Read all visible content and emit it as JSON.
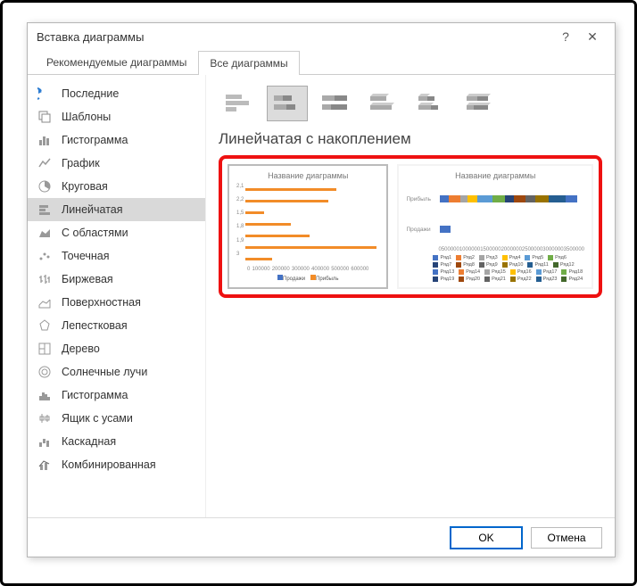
{
  "dialog": {
    "title": "Вставка диаграммы",
    "help": "?",
    "close": "✕"
  },
  "tabs": {
    "recommended": "Рекомендуемые диаграммы",
    "all": "Все диаграммы"
  },
  "sidebar": [
    "Последние",
    "Шаблоны",
    "Гистограмма",
    "График",
    "Круговая",
    "Линейчатая",
    "С областями",
    "Точечная",
    "Биржевая",
    "Поверхностная",
    "Лепестковая",
    "Дерево",
    "Солнечные лучи",
    "Гистограмма",
    "Ящик с усами",
    "Каскадная",
    "Комбинированная"
  ],
  "subtypeHeading": "Линейчатая с накоплением",
  "preview1": {
    "title": "Название диаграммы",
    "ylabels": [
      "2,1",
      "2,2",
      "1,5",
      "1,8",
      "1,9",
      "3",
      ""
    ],
    "xlabels": [
      "0",
      "100000",
      "200000",
      "300000",
      "400000",
      "500000",
      "600000"
    ],
    "legend": [
      "Продажи",
      "Прибыль"
    ]
  },
  "preview2": {
    "title": "Название диаграммы",
    "rows": [
      "Прибыль",
      "Продажи"
    ],
    "xlabels": [
      "0",
      "500000",
      "1000000",
      "1500000",
      "2000000",
      "2500000",
      "3000000",
      "3500000"
    ],
    "legend": [
      "Ряд1",
      "Ряд2",
      "Ряд3",
      "Ряд4",
      "Ряд5",
      "Ряд6",
      "Ряд7",
      "Ряд8",
      "Ряд9",
      "Ряд10",
      "Ряд11",
      "Ряд12",
      "Ряд13",
      "Ряд14",
      "Ряд15",
      "Ряд16",
      "Ряд17",
      "Ряд18",
      "Ряд19",
      "Ряд20",
      "Ряд21",
      "Ряд22",
      "Ряд23",
      "Ряд24"
    ]
  },
  "footer": {
    "ok": "OK",
    "cancel": "Отмена"
  },
  "chart_data": [
    {
      "type": "bar",
      "orientation": "horizontal",
      "stacked": true,
      "title": "Название диаграммы",
      "categories": [
        "2,1",
        "2,2",
        "1,5",
        "1,8",
        "1,9",
        "3",
        ""
      ],
      "series": [
        {
          "name": "Продажи",
          "color": "#4472c4",
          "values": [
            30000,
            20000,
            10000,
            15000,
            10000,
            50000,
            40000
          ]
        },
        {
          "name": "Прибыль",
          "color": "#f28c28",
          "values": [
            380000,
            350000,
            70000,
            190000,
            280000,
            550000,
            80000
          ]
        }
      ],
      "xlim": [
        0,
        600000
      ]
    },
    {
      "type": "bar",
      "orientation": "horizontal",
      "stacked": true,
      "title": "Название диаграммы",
      "categories": [
        "Прибыль",
        "Продажи"
      ],
      "series_count": 24,
      "xlim": [
        0,
        3500000
      ]
    }
  ]
}
